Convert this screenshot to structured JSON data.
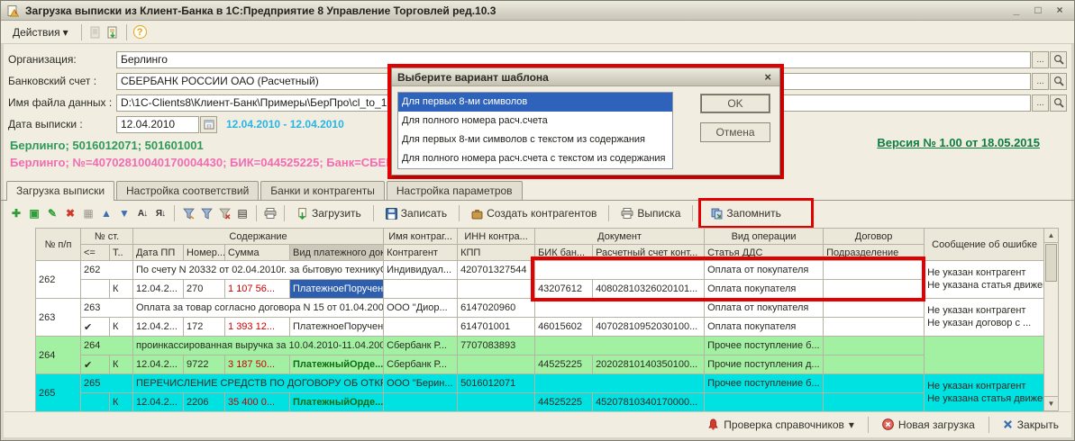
{
  "window": {
    "title": "Загрузка выписки из Клиент-Банка в 1С:Предприятие 8 Управление Торговлей ред.10.3",
    "minimize": "_",
    "maximize": "□",
    "close": "×"
  },
  "menubar": {
    "actions": "Действия",
    "actions_arrow": "▾",
    "help": "?"
  },
  "form": {
    "org_label": "Организация:",
    "org_value": "Берлинго",
    "account_label": "Банковский счет :",
    "account_value": "СБЕРБАНК РОССИИ ОАО (Расчетный)",
    "file_label": "Имя файла данных :",
    "file_value": "D:\\1C-Clients8\\Клиент-Банк\\Примеры\\БерПро\\cl_to_1c-Сб",
    "date_label": "Дата выписки :",
    "date_value": "12.04.2010",
    "date_range": "12.04.2010 - 12.04.2010",
    "org_info": "Берлинго; 5016012071; 501601001",
    "bank_info": "Берлинго; №=40702810040170004430; БИК=044525225; Банк=СБЕРБА",
    "version_link": "Версия № 1.00 от 18.05.2015",
    "ellipsis": "..."
  },
  "dialog": {
    "title": "Выберите вариант шаблона",
    "close": "×",
    "items": [
      "Для первых 8-ми символов",
      "Для полного номера расч.счета",
      "Для первых 8-ми символов с текстом из содержания",
      "Для полного номера расч.счета с текстом из содержания"
    ],
    "selected_index": 0,
    "ok": "OK",
    "cancel": "Отмена"
  },
  "tabs": [
    "Загрузка выписки",
    "Настройка соответствий",
    "Банки и контрагенты",
    "Настройка параметров"
  ],
  "toolbar": {
    "load": "Загрузить",
    "save": "Записать",
    "create": "Создать контрагентов",
    "statement": "Выписка",
    "remember": "Запомнить"
  },
  "icons": {
    "add": "✚",
    "copy": "▣",
    "edit": "✎",
    "delete": "✖",
    "disabled": "▦",
    "up": "▲",
    "down": "▼",
    "sort_asc": "А↓",
    "sort_desc": "Я↓",
    "settings": "▤",
    "dropdown": "▾"
  },
  "table": {
    "headers": {
      "npp": "№ п/п",
      "nst": "№ ст.",
      "content": "Содержание",
      "check": "<=",
      "t": "Т..",
      "date": "Дата ПП",
      "num": "Номер...",
      "sum": "Сумма",
      "doc_kind": "Вид платежного док...",
      "name_group": "Имя контраг...",
      "contractor": "Контрагент",
      "inn_group": "ИНН контра...",
      "kpp": "КПП",
      "doc_group": "Документ",
      "bik": "БИК бан...",
      "account": "Расчетный счет конт...",
      "op_group": "Вид операции",
      "dds": "Статья ДДС",
      "dogovor_group": "Договор",
      "subdiv": "Подразделение",
      "error": "Сообщение об ошибке"
    },
    "rows": [
      {
        "npp": "262",
        "nst": "262",
        "content": "По счету N 20332 от 02.04.2010г. за бытовую техникуСу...",
        "contractor": "Индивидуал...",
        "inn": "420701327544",
        "op": "Оплата от покупателя",
        "dogovor": "",
        "err1": "Не указан контрагент",
        "err2": "Не указана статья движен...",
        "check": "",
        "t": "К",
        "date": "12.04.2...",
        "num": "270",
        "sum": "1 107 56...",
        "doc": "ПлатежноеПоручен...",
        "contractor2": "",
        "kpp": "",
        "bik": "43207612",
        "account": "40802810326020101...",
        "dds": "Оплата покупателя",
        "subdiv": ""
      },
      {
        "npp": "263",
        "nst": "263",
        "content": "Оплата за товар согласно договора N 15 от 01.04.2008г...",
        "contractor": "ООО \"Диор...",
        "inn": "6147020960",
        "op": "Оплата от покупателя",
        "dogovor": "",
        "err1": "Не указан контрагент",
        "err2": "Не указан договор с ...",
        "check": "✔",
        "t": "К",
        "date": "12.04.2...",
        "num": "172",
        "sum": "1 393 12...",
        "doc": "ПлатежноеПоручен...",
        "contractor2": "",
        "kpp": "614701001",
        "bik": "46015602",
        "account": "40702810952030100...",
        "dds": "Оплата покупателя",
        "subdiv": ""
      },
      {
        "npp": "264",
        "nst": "264",
        "content": "проинкассированная выручка за 10.04.2010-11.04.20010",
        "contractor": "Сбербанк Р...",
        "inn": "7707083893",
        "op": "Прочее поступление б...",
        "dogovor": "",
        "err1": "",
        "err2": "",
        "check": "✔",
        "t": "К",
        "date": "12.04.2...",
        "num": "9722",
        "sum": "3 187 50...",
        "doc": "ПлатежныйОрде...",
        "contractor2": "Сбербанк Р...",
        "kpp": "",
        "bik": "44525225",
        "account": "20202810140350100...",
        "dds": "Прочие поступления д...",
        "subdiv": ""
      },
      {
        "npp": "265",
        "nst": "265",
        "content": "ПЕРЕЧИСЛЕНИЕ СРЕДСТВ ПО ДОГОВОРУ ОБ ОТКР...",
        "contractor": "ООО \"Берин...",
        "inn": "5016012071",
        "op": "Прочее поступление б...",
        "dogovor": "",
        "err1": "Не указан контрагент",
        "err2": "Не указана статья движен...",
        "check": "",
        "t": "К",
        "date": "12.04.2...",
        "num": "2206",
        "sum": "35 400 0...",
        "doc": "ПлатежныйОрде...",
        "contractor2": "",
        "kpp": "",
        "bik": "44525225",
        "account": "45207810340170000...",
        "dds": "",
        "subdiv": ""
      }
    ]
  },
  "statusbar": {
    "check_refs": "Проверка справочников",
    "dropdown": "▾",
    "new_load": "Новая загрузка",
    "close": "Закрыть"
  },
  "colors": {
    "annotation_red": "#e30000",
    "row_green": "#a2f0a2",
    "row_cyan": "#00e2e2",
    "selection_blue": "#2e5fae",
    "sum_red": "#c80000",
    "bank_info_pink": "#f26cb2",
    "org_info_green": "#2f9a5a",
    "date_range_cyan": "#27b5e6",
    "version_green": "#0c7d3f"
  }
}
